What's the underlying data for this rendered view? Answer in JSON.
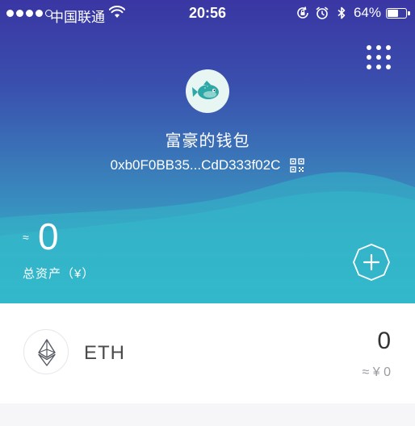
{
  "status_bar": {
    "carrier": "中国联通",
    "time": "20:56",
    "battery_percent_label": "64%",
    "battery_level": 0.64,
    "icons": [
      "signal-dots-icon",
      "wifi-icon",
      "orientation-lock-icon",
      "alarm-icon",
      "bluetooth-icon",
      "battery-icon"
    ]
  },
  "header": {
    "menu_icon": "grid-menu-icon",
    "avatar_icon": "fish-avatar-icon",
    "wallet_name": "富豪的钱包",
    "address": "0xb0F0BB35...CdD333f02C",
    "qr_icon": "qr-code-icon"
  },
  "summary": {
    "approx_symbol": "≈",
    "total_value": "0",
    "total_label": "总资产（¥）",
    "add_icon": "add-token-icon"
  },
  "assets": [
    {
      "symbol": "ETH",
      "icon": "ethereum-icon",
      "amount": "0",
      "fiat_value": "≈ ¥ 0"
    }
  ],
  "colors": {
    "gradient_top": "#3a36a3",
    "gradient_bottom": "#2fb3c8",
    "list_background": "#f6f6f8"
  }
}
